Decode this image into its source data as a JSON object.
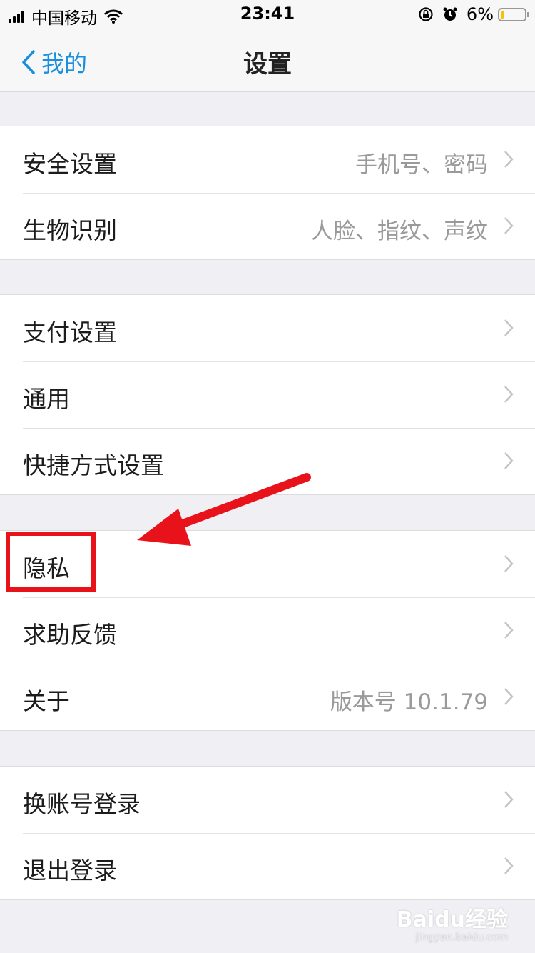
{
  "status_bar": {
    "carrier": "中国移动",
    "time": "23:41",
    "battery": "6%",
    "battery_level": 0.06
  },
  "nav": {
    "back_label": "我的",
    "title": "设置"
  },
  "groups": [
    {
      "items": [
        {
          "label": "安全设置",
          "value": "手机号、密码"
        },
        {
          "label": "生物识别",
          "value": "人脸、指纹、声纹"
        }
      ]
    },
    {
      "items": [
        {
          "label": "支付设置",
          "value": ""
        },
        {
          "label": "通用",
          "value": ""
        },
        {
          "label": "快捷方式设置",
          "value": ""
        }
      ]
    },
    {
      "items": [
        {
          "label": "隐私",
          "value": ""
        },
        {
          "label": "求助反馈",
          "value": ""
        },
        {
          "label": "关于",
          "value": "版本号 10.1.79"
        }
      ]
    },
    {
      "items": [
        {
          "label": "换账号登录",
          "value": ""
        },
        {
          "label": "退出登录",
          "value": ""
        }
      ]
    }
  ],
  "annotation": {
    "highlight_color": "#e8121a",
    "highlighted_item": "隐私"
  },
  "watermark": {
    "text": "Baidu经验",
    "url_text": "jingyan.baidu.com"
  },
  "colors": {
    "accent": "#1a8fe0",
    "background": "#efeff4"
  }
}
